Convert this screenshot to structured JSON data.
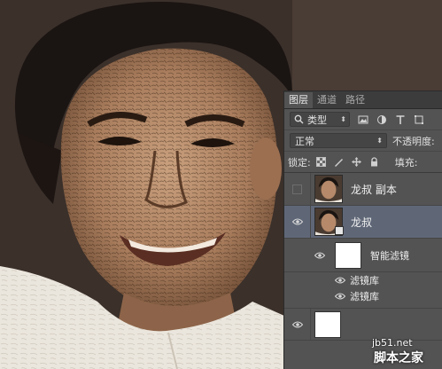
{
  "panel": {
    "tabs": [
      {
        "label": "图层",
        "active": true
      },
      {
        "label": "通道",
        "active": false
      },
      {
        "label": "路径",
        "active": false
      }
    ],
    "filter_kind": "类型",
    "blend_mode": "正常",
    "opacity_label": "不透明度:",
    "lock_label": "锁定:",
    "fill_label": "填充:"
  },
  "layers": [
    {
      "name": "龙叔 副本",
      "visible": false,
      "selected": false
    },
    {
      "name": "龙叔",
      "visible": true,
      "selected": true,
      "smart_object": true
    }
  ],
  "smart_filters": {
    "label": "智能滤镜",
    "items": [
      {
        "label": "滤镜库"
      },
      {
        "label": "滤镜库"
      }
    ]
  },
  "watermark": {
    "site": "jb51.net",
    "brand": "脚本之家"
  },
  "colors": {
    "panel_bg": "#535353",
    "selected_row": "#5f6777",
    "tab_bar": "#3c3c3c"
  }
}
